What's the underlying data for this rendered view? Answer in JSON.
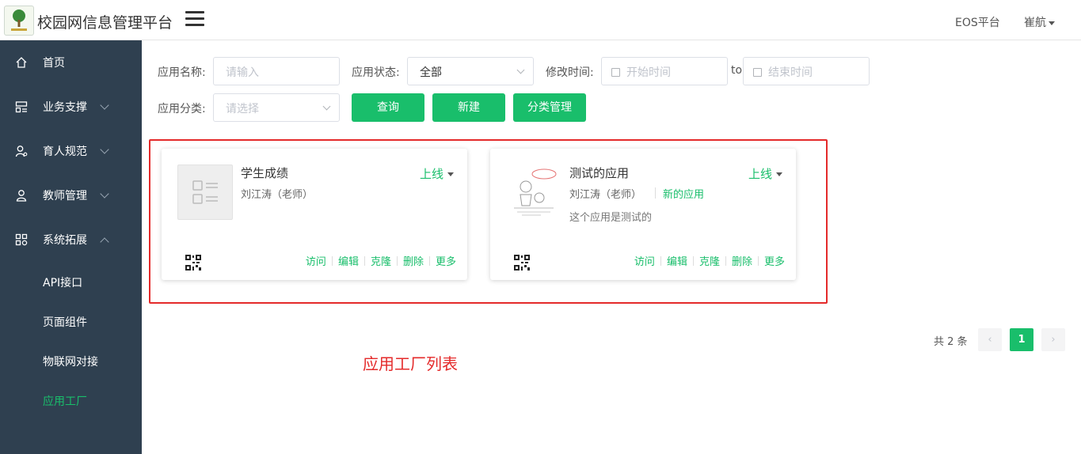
{
  "header": {
    "title": "校园网信息管理平台",
    "eos_link": "EOS平台",
    "user": "崔航"
  },
  "sidebar": {
    "items": [
      {
        "label": "首页",
        "icon": "home-icon"
      },
      {
        "label": "业务支撑",
        "icon": "layout-icon"
      },
      {
        "label": "育人规范",
        "icon": "user-settings-icon"
      },
      {
        "label": "教师管理",
        "icon": "teacher-icon"
      },
      {
        "label": "系统拓展",
        "icon": "apps-icon"
      }
    ],
    "sub_items": [
      "API接口",
      "页面组件",
      "物联网对接",
      "应用工厂"
    ],
    "active_sub": "应用工厂"
  },
  "filters": {
    "name_label": "应用名称:",
    "name_placeholder": "请输入",
    "status_label": "应用状态:",
    "status_value": "全部",
    "time_label": "修改时间:",
    "start_placeholder": "开始时间",
    "to": "to",
    "end_placeholder": "结束时间",
    "category_label": "应用分类:",
    "category_placeholder": "请选择"
  },
  "buttons": {
    "query": "查询",
    "create": "新建",
    "category_manage": "分类管理"
  },
  "cards": [
    {
      "title": "学生成绩",
      "author": "刘江涛（老师）",
      "tag": "",
      "description": "",
      "status": "上线",
      "actions": [
        "访问",
        "编辑",
        "克隆",
        "删除",
        "更多"
      ]
    },
    {
      "title": "测试的应用",
      "author": "刘江涛（老师）",
      "tag": "新的应用",
      "description": "这个应用是测试的",
      "status": "上线",
      "actions": [
        "访问",
        "编辑",
        "克隆",
        "删除",
        "更多"
      ]
    }
  ],
  "annotation": "应用工厂列表",
  "pagination": {
    "total": "共 2 条",
    "current_page": "1",
    "prev": "‹",
    "next": "›"
  },
  "colors": {
    "sidebar_bg": "#2f4050",
    "accent": "#19be6b",
    "highlight": "#e42a2a"
  }
}
